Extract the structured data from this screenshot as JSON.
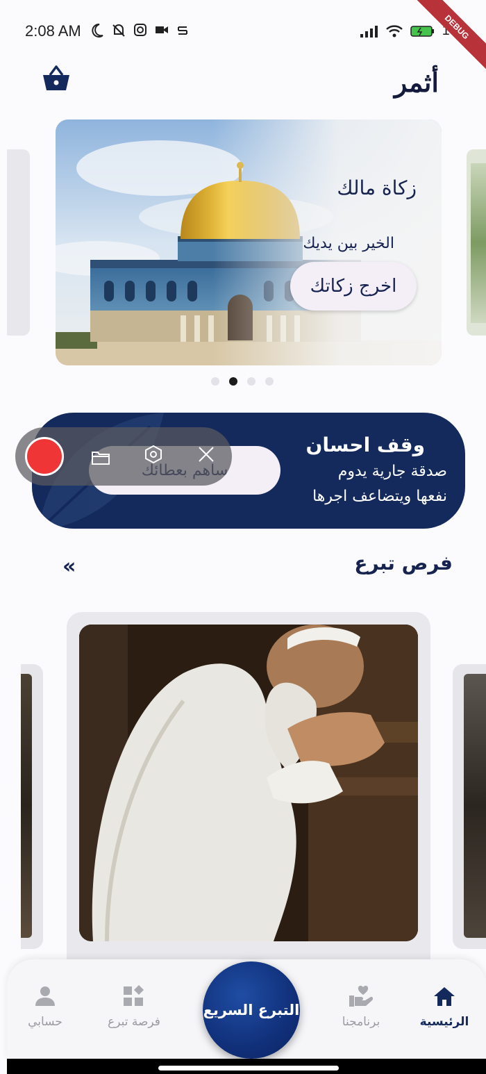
{
  "status_bar": {
    "time": "2:08 AM",
    "battery": "100",
    "debug_ribbon": "DEBUG"
  },
  "header": {
    "logo_text": "أثمر"
  },
  "banner": {
    "title": "زكاة مالك",
    "subtitle": "الخير بين يديك",
    "button_label": "اخرج زكاتك",
    "pages": 4,
    "active_page": 2
  },
  "waqf": {
    "title": "وقف احسان",
    "line1": "صدقة جارية يدوم",
    "line2": "نفعها ويتضاعف اجرها",
    "button_label": "ساهم بعطائك"
  },
  "opportunities": {
    "title": "فرص تبرع",
    "more_symbol": "«"
  },
  "bottom_nav": {
    "items": [
      {
        "label": "الرئيسية",
        "icon": "home-icon",
        "active": true
      },
      {
        "label": "برنامجنا",
        "icon": "hand-heart-icon",
        "active": false
      },
      {
        "label": "فرصة تبرع",
        "icon": "grid-icon",
        "active": false
      },
      {
        "label": "حسابي",
        "icon": "person-icon",
        "active": false
      }
    ],
    "fab_label": "التبرع السريع"
  },
  "colors": {
    "primary": "#142a5c",
    "record": "#ef3535",
    "ribbon": "#b8323a"
  }
}
